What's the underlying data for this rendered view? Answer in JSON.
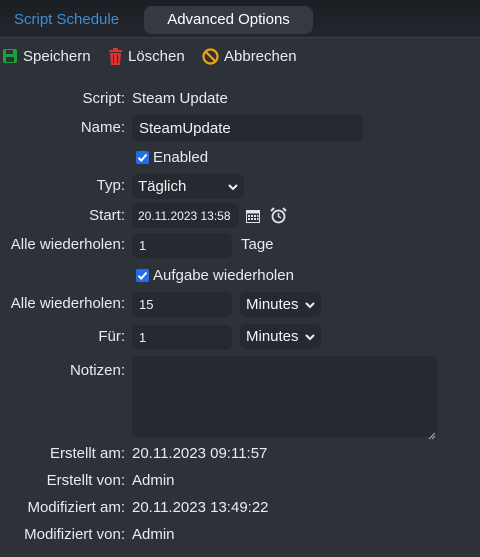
{
  "tabs": {
    "schedule": "Script Schedule",
    "advanced": "Advanced Options"
  },
  "toolbar": {
    "save": "Speichern",
    "delete": "Löschen",
    "cancel": "Abbrechen"
  },
  "colors": {
    "background": "#2d3138",
    "input_bg": "#262a30",
    "tab_active": "#3f8fd8",
    "save_icon": "#1e9e3e",
    "delete_icon": "#e03131",
    "cancel_icon": "#f0a30a",
    "checkbox": "#1f6feb"
  },
  "form": {
    "script": {
      "label": "Script:",
      "value": "Steam Update"
    },
    "name": {
      "label": "Name:",
      "value": "SteamUpdate"
    },
    "enabled": {
      "label": "Enabled",
      "checked": true
    },
    "type": {
      "label": "Typ:",
      "value": "Täglich"
    },
    "start": {
      "label": "Start:",
      "value": "20.11.2023 13:58",
      "calendar_icon": "calendar-icon",
      "alarm_icon": "alarm-clock-icon"
    },
    "repeat_every": {
      "label": "Alle wiederholen:",
      "value": "1",
      "unit": "Tage"
    },
    "repeat_task": {
      "label": "Aufgabe wiederholen",
      "checked": true
    },
    "repeat_interval": {
      "label": "Alle wiederholen:",
      "value": "15",
      "unit": "Minutes"
    },
    "duration": {
      "label": "Für:",
      "value": "1",
      "unit": "Minutes"
    },
    "notes": {
      "label": "Notizen:",
      "value": ""
    }
  },
  "info": {
    "created_at": {
      "label": "Erstellt am:",
      "value": "20.11.2023 09:11:57"
    },
    "created_by": {
      "label": "Erstellt von:",
      "value": "Admin"
    },
    "modified_at": {
      "label": "Modifiziert am:",
      "value": "20.11.2023 13:49:22"
    },
    "modified_by": {
      "label": "Modifiziert von:",
      "value": "Admin"
    }
  }
}
